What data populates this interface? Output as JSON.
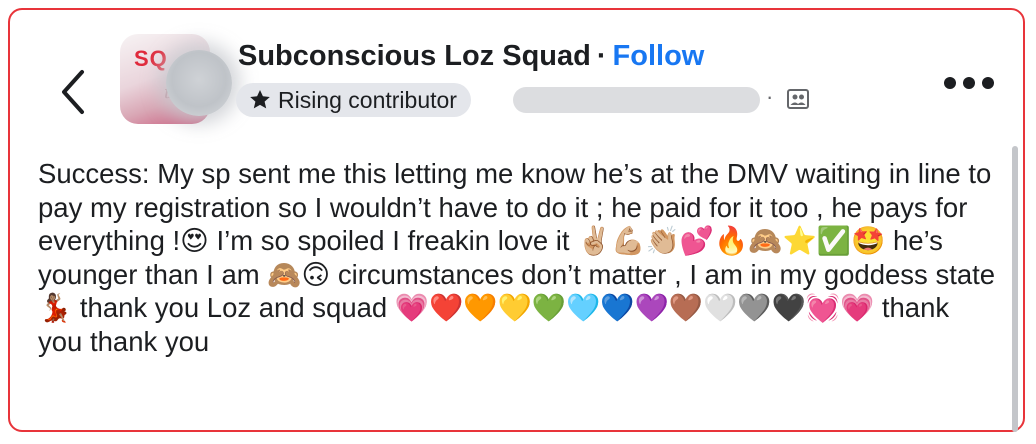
{
  "header": {
    "group_name": "Subconscious Loz Squad",
    "separator": "·",
    "follow_label": "Follow",
    "badge_label": "Rising contributor",
    "meta_dot": "·"
  },
  "group_avatar": {
    "text_top": "SQ",
    "text_script": "th"
  },
  "post": {
    "text": "Success: My sp sent me this letting me know he’s at the DMV waiting in line to pay my registration so I wouldn’t have to do it ; he paid for it too , he pays for everything !😍 I’m so spoiled I freakin love it ✌🏼💪🏼👏🏼💕🔥🙈⭐✅🤩 he’s younger than I am 🙈🙃 circumstances don’t matter , I am in my goddess state 💃🏽 thank you Loz and squad 💗❤️🧡💛💚🩵💙💜🤎🤍🩶🖤💓💗 thank you thank you"
  },
  "icons": [
    "chevron-left-icon",
    "star-icon",
    "audience-icon",
    "more-icon"
  ],
  "colors": {
    "follow": "#1877f2",
    "badge_bg": "#e4e6eb",
    "text": "#1c1e21",
    "border": "#e8343a"
  }
}
